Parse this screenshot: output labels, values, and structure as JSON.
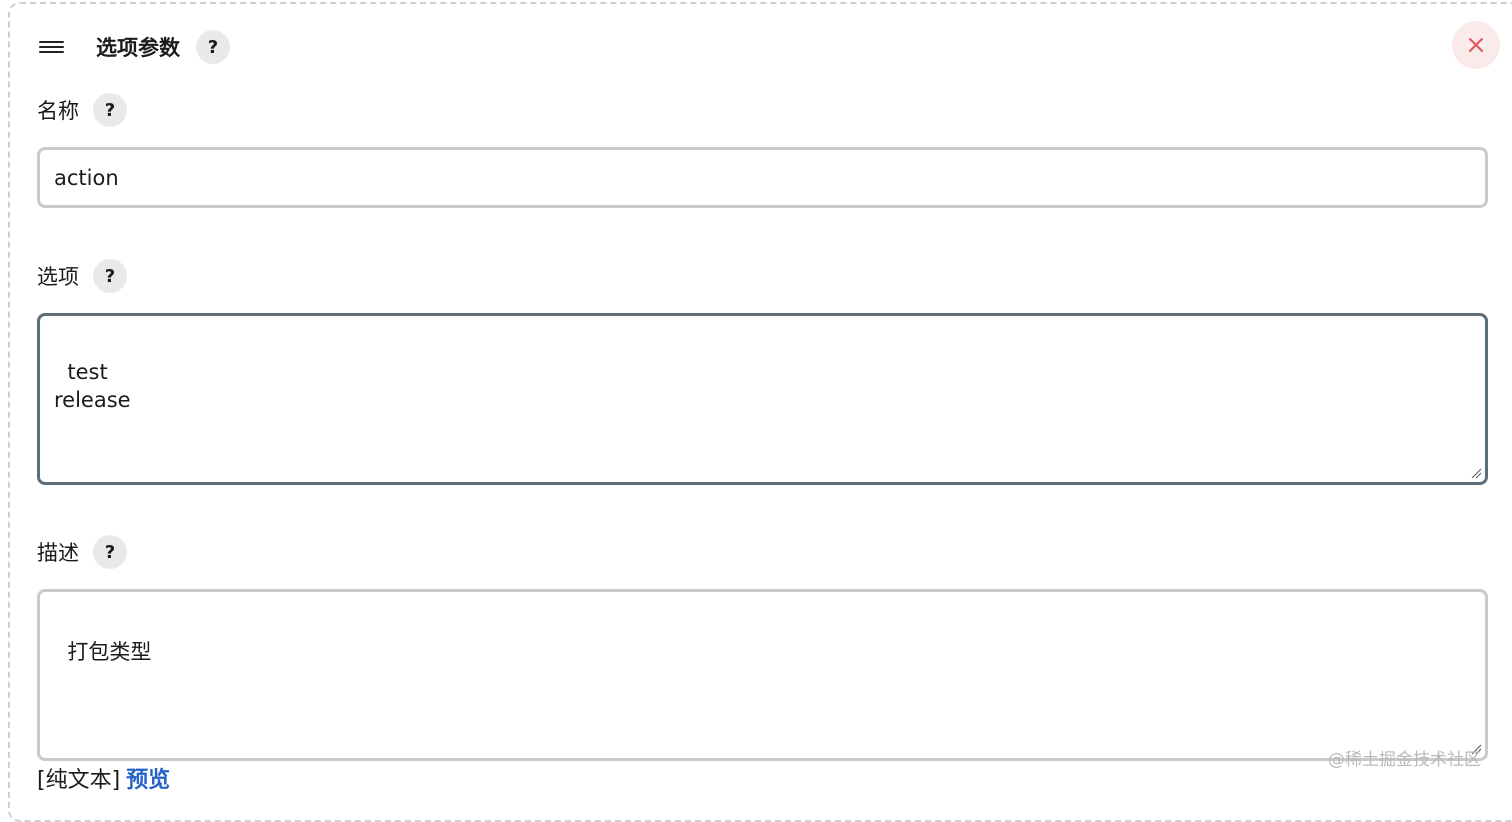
{
  "header": {
    "title": "选项参数",
    "help": "?",
    "close_icon": "close-icon",
    "drag_icon": "drag-handle-icon"
  },
  "fields": {
    "name": {
      "label": "名称",
      "help": "?",
      "value": "action"
    },
    "choices": {
      "label": "选项",
      "help": "?",
      "value": "test\nrelease"
    },
    "description": {
      "label": "描述",
      "help": "?",
      "value": "打包类型"
    }
  },
  "footer": {
    "plain_text": "[纯文本]",
    "preview": "预览"
  },
  "watermark": "@稀土掘金技术社区",
  "colors": {
    "close_bg": "#fbeaea",
    "close_x": "#e05757",
    "link": "#2563c9",
    "focused_border": "#5d6d7a"
  }
}
